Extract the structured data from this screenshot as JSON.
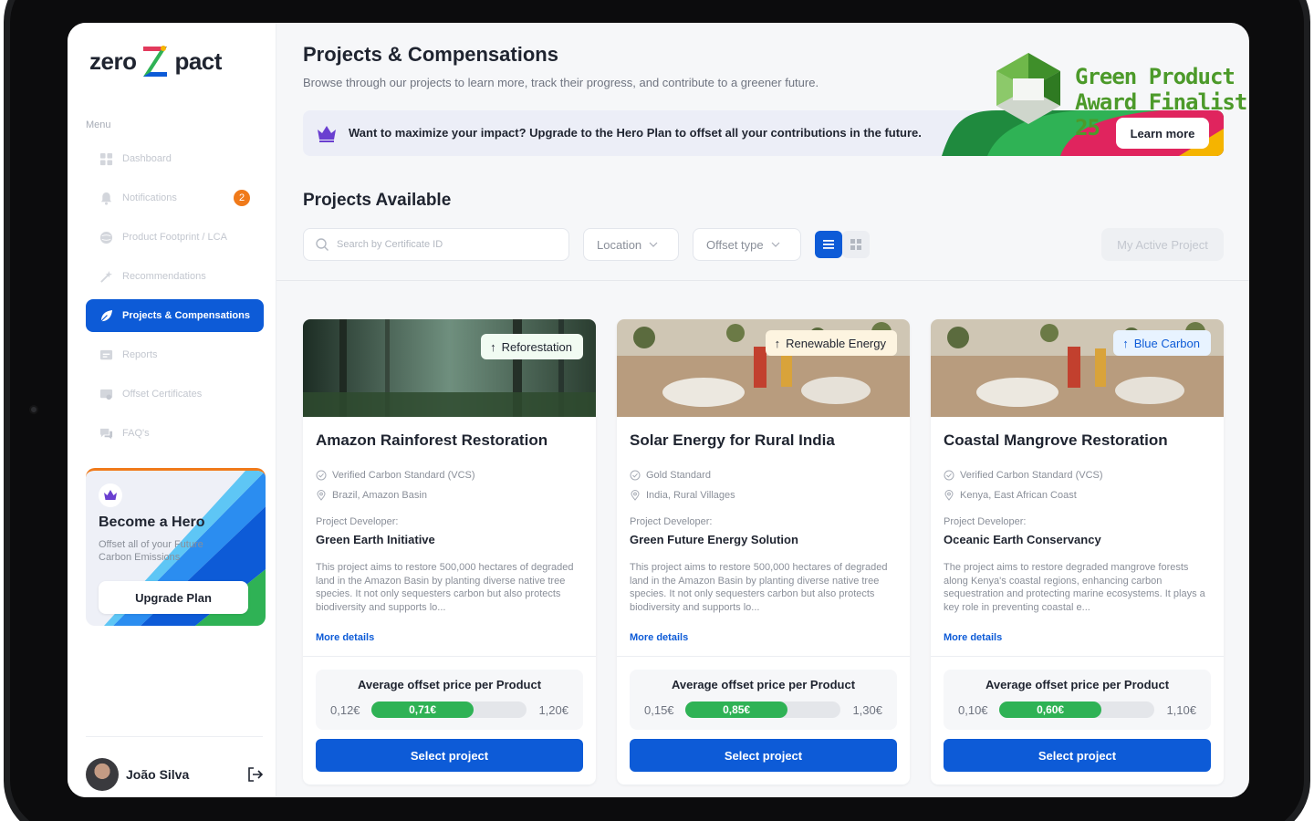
{
  "app": {
    "logo_left": "zero",
    "logo_right": "pact"
  },
  "award": {
    "line1": "Green Product",
    "line2": "Award Finalist 25"
  },
  "sidebar": {
    "menu_label": "Menu",
    "items": [
      {
        "label": "Dashboard",
        "icon": "dashboard-icon"
      },
      {
        "label": "Notifications",
        "icon": "bell-icon",
        "badge": "2"
      },
      {
        "label": "Product Footprint / LCA",
        "icon": "globe-icon"
      },
      {
        "label": "Recommendations",
        "icon": "sparkle-icon"
      },
      {
        "label": "Projects & Compensations",
        "icon": "leaf-icon",
        "active": true
      },
      {
        "label": "Reports",
        "icon": "report-icon"
      },
      {
        "label": "Offset Certificates",
        "icon": "certificate-icon"
      },
      {
        "label": "FAQ's",
        "icon": "chat-icon"
      }
    ],
    "hero_card": {
      "title": "Become a Hero",
      "subtitle": "Offset all of your Future Carbon Emissions",
      "button": "Upgrade Plan"
    },
    "user": {
      "name": "João Silva"
    }
  },
  "header": {
    "title": "Projects & Compensations",
    "subtitle": "Browse through our projects to learn more, track their progress, and contribute to a greener future."
  },
  "banner": {
    "text": "Want to maximize your impact? Upgrade to the Hero Plan to offset all your contributions in the future.",
    "button": "Learn more"
  },
  "projects_section": {
    "title": "Projects Available",
    "search_placeholder": "Search by Certificate ID",
    "location_filter": "Location",
    "offset_filter": "Offset type",
    "active_project_button": "My Active Project"
  },
  "colors": {
    "accent": "#0d5bd7",
    "green": "#2fb255",
    "badge": "#f07a1a"
  },
  "cards": [
    {
      "tag": "Reforestation",
      "title": "Amazon Rainforest Restoration",
      "standard": "Verified Carbon Standard (VCS)",
      "location": "Brazil, Amazon Basin",
      "developer_label": "Project Developer:",
      "developer": "Green Earth Initiative",
      "description": "This project aims to restore 500,000 hectares of degraded land in the Amazon Basin by planting diverse native tree species. It not only sequesters carbon but also protects biodiversity and supports lo...",
      "more": "More details",
      "price_label": "Average offset price per Product",
      "price_min": "0,12€",
      "price_avg": "0,71€",
      "price_max": "1,20€",
      "price_fill": 0.66,
      "button": "Select project"
    },
    {
      "tag": "Renewable Energy",
      "title": "Solar Energy for Rural India",
      "standard": "Gold Standard",
      "location": "India, Rural Villages",
      "developer_label": "Project Developer:",
      "developer": "Green Future Energy Solution",
      "description": "This project aims to restore 500,000 hectares of degraded land in the Amazon Basin by planting diverse native tree species. It not only sequesters carbon but also protects biodiversity and supports lo...",
      "more": "More details",
      "price_label": "Average offset price per Product",
      "price_min": "0,15€",
      "price_avg": "0,85€",
      "price_max": "1,30€",
      "price_fill": 0.66,
      "button": "Select project"
    },
    {
      "tag": "Blue Carbon",
      "title": "Coastal Mangrove Restoration",
      "standard": "Verified Carbon Standard (VCS)",
      "location": "Kenya, East African Coast",
      "developer_label": "Project Developer:",
      "developer": "Oceanic Earth Conservancy",
      "description": "The project aims to restore degraded mangrove forests along Kenya's coastal regions, enhancing carbon sequestration and protecting marine ecosystems. It plays a key role in preventing coastal e...",
      "more": "More details",
      "price_label": "Average offset price per Product",
      "price_min": "0,10€",
      "price_avg": "0,60€",
      "price_max": "1,10€",
      "price_fill": 0.66,
      "button": "Select project"
    }
  ]
}
